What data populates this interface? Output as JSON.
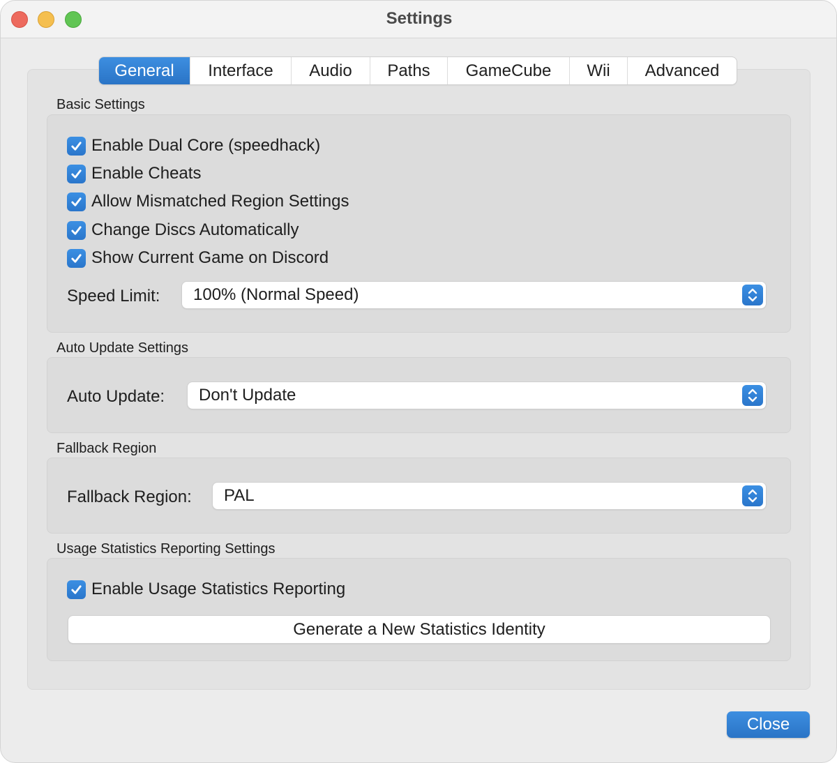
{
  "window": {
    "title": "Settings"
  },
  "tabs": [
    {
      "label": "General",
      "active": true
    },
    {
      "label": "Interface",
      "active": false
    },
    {
      "label": "Audio",
      "active": false
    },
    {
      "label": "Paths",
      "active": false
    },
    {
      "label": "GameCube",
      "active": false
    },
    {
      "label": "Wii",
      "active": false
    },
    {
      "label": "Advanced",
      "active": false
    }
  ],
  "basic_settings": {
    "title": "Basic Settings",
    "checkboxes": [
      {
        "label": "Enable Dual Core (speedhack)",
        "checked": true
      },
      {
        "label": "Enable Cheats",
        "checked": true
      },
      {
        "label": "Allow Mismatched Region Settings",
        "checked": true
      },
      {
        "label": "Change Discs Automatically",
        "checked": true
      },
      {
        "label": "Show Current Game on Discord",
        "checked": true
      }
    ],
    "speed_limit": {
      "label": "Speed Limit:",
      "value": "100% (Normal Speed)"
    }
  },
  "auto_update_settings": {
    "title": "Auto Update Settings",
    "auto_update": {
      "label": "Auto Update:",
      "value": "Don't Update"
    }
  },
  "fallback_region": {
    "title": "Fallback Region",
    "region": {
      "label": "Fallback Region:",
      "value": "PAL"
    }
  },
  "usage_statistics": {
    "title": "Usage Statistics Reporting Settings",
    "checkbox": {
      "label": "Enable Usage Statistics Reporting",
      "checked": true
    },
    "generate_button": "Generate a New Statistics Identity"
  },
  "footer": {
    "close_label": "Close"
  },
  "colors": {
    "accent": "#2f7fd1",
    "window_bg": "#ececec",
    "group_bg": "#dcdcdc"
  },
  "icons": {
    "check": "checkmark-icon",
    "stepper": "up-down-chevron-icon"
  }
}
